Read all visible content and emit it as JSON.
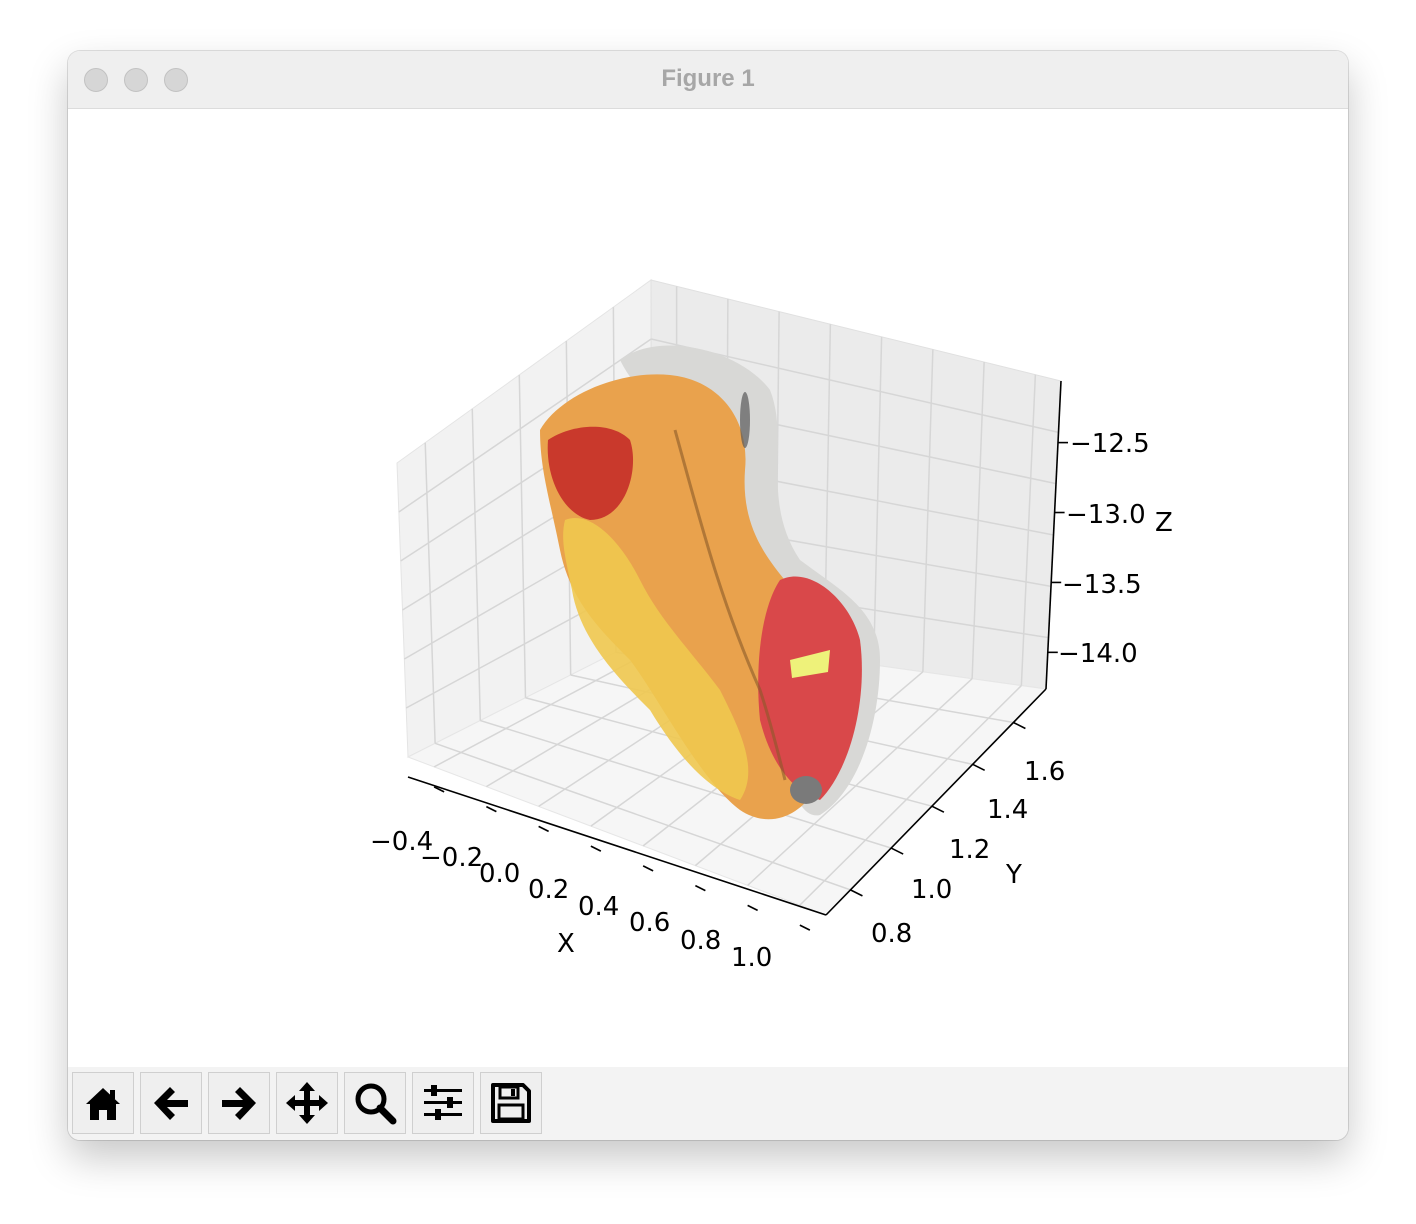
{
  "window": {
    "title": "Figure 1"
  },
  "toolbar": {
    "buttons": [
      {
        "name": "home-button",
        "icon": "home-icon"
      },
      {
        "name": "back-button",
        "icon": "arrow-left-icon"
      },
      {
        "name": "forward-button",
        "icon": "arrow-right-icon"
      },
      {
        "name": "pan-button",
        "icon": "move-icon"
      },
      {
        "name": "zoom-button",
        "icon": "magnifier-icon"
      },
      {
        "name": "configure-subplots-button",
        "icon": "sliders-icon"
      },
      {
        "name": "save-button",
        "icon": "floppy-disk-icon"
      }
    ]
  },
  "chart_data": {
    "type": "scatter3d",
    "xlabel": "X",
    "ylabel": "Y",
    "zlabel": "Z",
    "xticks": [
      "−0.4",
      "−0.2",
      "0.0",
      "0.2",
      "0.4",
      "0.6",
      "0.8",
      "1.0"
    ],
    "yticks": [
      "0.8",
      "1.0",
      "1.2",
      "1.4",
      "1.6"
    ],
    "zticks": [
      "−12.5",
      "−13.0",
      "−13.5",
      "−14.0"
    ],
    "xlim": [
      -0.45,
      1.1
    ],
    "ylim": [
      0.7,
      1.7
    ],
    "zlim": [
      -14.3,
      -12.2
    ],
    "grid": true,
    "colors": {
      "orange": "#e8a24a",
      "red": "#d8453a",
      "yellow": "#f2d45a",
      "grey": "#cfcfcf",
      "dark": "#6b6b6b"
    }
  }
}
